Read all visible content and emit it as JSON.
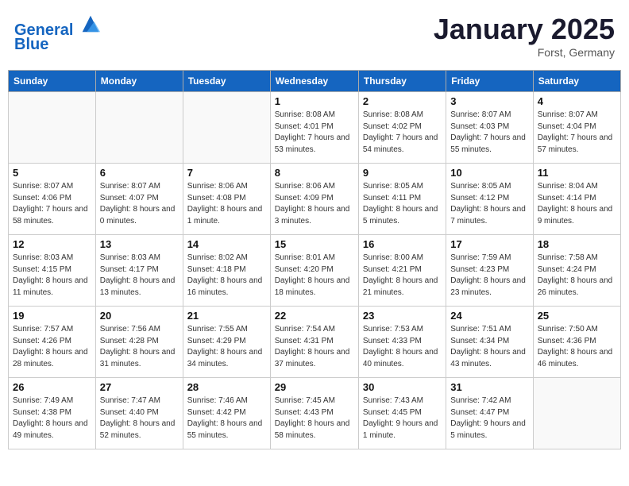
{
  "header": {
    "logo_line1": "General",
    "logo_line2": "Blue",
    "month": "January 2025",
    "location": "Forst, Germany"
  },
  "weekdays": [
    "Sunday",
    "Monday",
    "Tuesday",
    "Wednesday",
    "Thursday",
    "Friday",
    "Saturday"
  ],
  "weeks": [
    [
      {
        "day": "",
        "info": ""
      },
      {
        "day": "",
        "info": ""
      },
      {
        "day": "",
        "info": ""
      },
      {
        "day": "1",
        "info": "Sunrise: 8:08 AM\nSunset: 4:01 PM\nDaylight: 7 hours and 53 minutes."
      },
      {
        "day": "2",
        "info": "Sunrise: 8:08 AM\nSunset: 4:02 PM\nDaylight: 7 hours and 54 minutes."
      },
      {
        "day": "3",
        "info": "Sunrise: 8:07 AM\nSunset: 4:03 PM\nDaylight: 7 hours and 55 minutes."
      },
      {
        "day": "4",
        "info": "Sunrise: 8:07 AM\nSunset: 4:04 PM\nDaylight: 7 hours and 57 minutes."
      }
    ],
    [
      {
        "day": "5",
        "info": "Sunrise: 8:07 AM\nSunset: 4:06 PM\nDaylight: 7 hours and 58 minutes."
      },
      {
        "day": "6",
        "info": "Sunrise: 8:07 AM\nSunset: 4:07 PM\nDaylight: 8 hours and 0 minutes."
      },
      {
        "day": "7",
        "info": "Sunrise: 8:06 AM\nSunset: 4:08 PM\nDaylight: 8 hours and 1 minute."
      },
      {
        "day": "8",
        "info": "Sunrise: 8:06 AM\nSunset: 4:09 PM\nDaylight: 8 hours and 3 minutes."
      },
      {
        "day": "9",
        "info": "Sunrise: 8:05 AM\nSunset: 4:11 PM\nDaylight: 8 hours and 5 minutes."
      },
      {
        "day": "10",
        "info": "Sunrise: 8:05 AM\nSunset: 4:12 PM\nDaylight: 8 hours and 7 minutes."
      },
      {
        "day": "11",
        "info": "Sunrise: 8:04 AM\nSunset: 4:14 PM\nDaylight: 8 hours and 9 minutes."
      }
    ],
    [
      {
        "day": "12",
        "info": "Sunrise: 8:03 AM\nSunset: 4:15 PM\nDaylight: 8 hours and 11 minutes."
      },
      {
        "day": "13",
        "info": "Sunrise: 8:03 AM\nSunset: 4:17 PM\nDaylight: 8 hours and 13 minutes."
      },
      {
        "day": "14",
        "info": "Sunrise: 8:02 AM\nSunset: 4:18 PM\nDaylight: 8 hours and 16 minutes."
      },
      {
        "day": "15",
        "info": "Sunrise: 8:01 AM\nSunset: 4:20 PM\nDaylight: 8 hours and 18 minutes."
      },
      {
        "day": "16",
        "info": "Sunrise: 8:00 AM\nSunset: 4:21 PM\nDaylight: 8 hours and 21 minutes."
      },
      {
        "day": "17",
        "info": "Sunrise: 7:59 AM\nSunset: 4:23 PM\nDaylight: 8 hours and 23 minutes."
      },
      {
        "day": "18",
        "info": "Sunrise: 7:58 AM\nSunset: 4:24 PM\nDaylight: 8 hours and 26 minutes."
      }
    ],
    [
      {
        "day": "19",
        "info": "Sunrise: 7:57 AM\nSunset: 4:26 PM\nDaylight: 8 hours and 28 minutes."
      },
      {
        "day": "20",
        "info": "Sunrise: 7:56 AM\nSunset: 4:28 PM\nDaylight: 8 hours and 31 minutes."
      },
      {
        "day": "21",
        "info": "Sunrise: 7:55 AM\nSunset: 4:29 PM\nDaylight: 8 hours and 34 minutes."
      },
      {
        "day": "22",
        "info": "Sunrise: 7:54 AM\nSunset: 4:31 PM\nDaylight: 8 hours and 37 minutes."
      },
      {
        "day": "23",
        "info": "Sunrise: 7:53 AM\nSunset: 4:33 PM\nDaylight: 8 hours and 40 minutes."
      },
      {
        "day": "24",
        "info": "Sunrise: 7:51 AM\nSunset: 4:34 PM\nDaylight: 8 hours and 43 minutes."
      },
      {
        "day": "25",
        "info": "Sunrise: 7:50 AM\nSunset: 4:36 PM\nDaylight: 8 hours and 46 minutes."
      }
    ],
    [
      {
        "day": "26",
        "info": "Sunrise: 7:49 AM\nSunset: 4:38 PM\nDaylight: 8 hours and 49 minutes."
      },
      {
        "day": "27",
        "info": "Sunrise: 7:47 AM\nSunset: 4:40 PM\nDaylight: 8 hours and 52 minutes."
      },
      {
        "day": "28",
        "info": "Sunrise: 7:46 AM\nSunset: 4:42 PM\nDaylight: 8 hours and 55 minutes."
      },
      {
        "day": "29",
        "info": "Sunrise: 7:45 AM\nSunset: 4:43 PM\nDaylight: 8 hours and 58 minutes."
      },
      {
        "day": "30",
        "info": "Sunrise: 7:43 AM\nSunset: 4:45 PM\nDaylight: 9 hours and 1 minute."
      },
      {
        "day": "31",
        "info": "Sunrise: 7:42 AM\nSunset: 4:47 PM\nDaylight: 9 hours and 5 minutes."
      },
      {
        "day": "",
        "info": ""
      }
    ]
  ]
}
